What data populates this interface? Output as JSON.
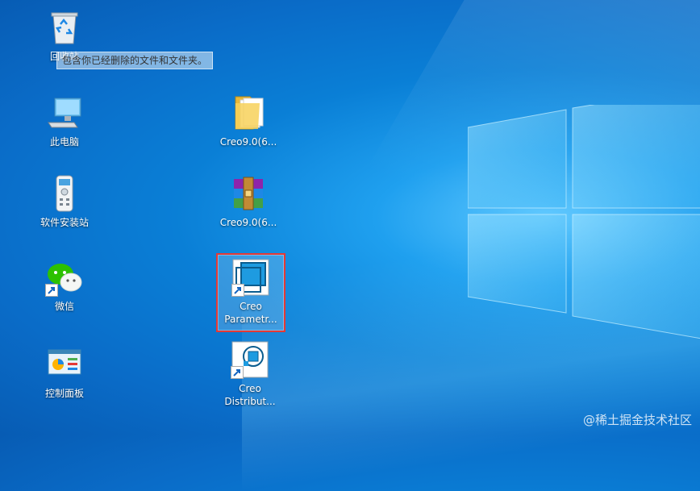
{
  "desktop": {
    "recycle_bin": {
      "label": "回收站",
      "tooltip": "包含你已经删除的文件和文件夹。"
    },
    "this_pc": {
      "label": "此电脑"
    },
    "software_station": {
      "label": "软件安装站"
    },
    "wechat": {
      "label": "微信"
    },
    "control_panel": {
      "label": "控制面板"
    },
    "folder": {
      "label": "Creo9.0(6..."
    },
    "archive": {
      "label": "Creo9.0(6..."
    },
    "creo_parametric": {
      "label_line1": "Creo",
      "label_line2": "Parametr..."
    },
    "creo_distributed": {
      "label_line1": "Creo",
      "label_line2": "Distribut..."
    }
  },
  "watermark": {
    "text": "@稀土掘金技术社区"
  },
  "colors": {
    "desktop_blue": "#0a7fd6",
    "selection_border": "#e53935"
  }
}
